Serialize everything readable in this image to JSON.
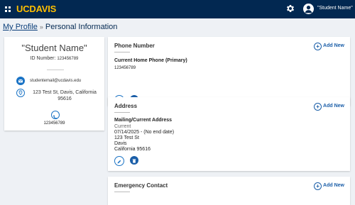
{
  "header": {
    "brand": "UCDAVIS",
    "user_name": "\"Student Name\""
  },
  "breadcrumb": {
    "link": "My Profile",
    "separator": "»",
    "current": "Personal Information"
  },
  "profile": {
    "name": "\"Student Name\"",
    "id_label": "ID Number:",
    "id_value": "123456789",
    "email": "studentemail@ucdavis.edu",
    "address": "123 Test St, Davis, California 95616",
    "phone": "123456789"
  },
  "phone_section": {
    "title": "Phone Number",
    "add_label": "Add New",
    "item_title": "Current Home Phone (Primary)",
    "item_value": "123456789"
  },
  "address_section": {
    "title": "Address",
    "add_label": "Add New",
    "item_title": "Mailing/Current Address",
    "status": "Current",
    "date_range": "07/14/2025 - (No end date)",
    "line1": "123 Test St",
    "line2": "Davis",
    "line3": "California 95616"
  },
  "emergency_section": {
    "title": "Emergency Contact",
    "add_label": "Add New"
  },
  "colors": {
    "header_bg": "#022851",
    "brand": "#ffbf00",
    "accent": "#1a73c5"
  }
}
